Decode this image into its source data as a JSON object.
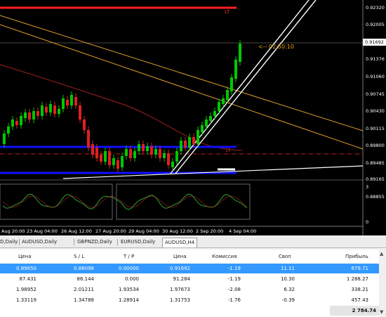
{
  "chart": {
    "price_axis": [
      "0.92320",
      "0.92005",
      "0.91692",
      "0.91376",
      "0.91060",
      "0.90745",
      "0.90430",
      "0.90115",
      "0.89800",
      "0.89485",
      "0.89165",
      "0.88855"
    ],
    "current_price": "0.91692",
    "timer": "<-- 02:50:10",
    "line_label_top": "LT",
    "line_label_mid": "LT",
    "time_axis": [
      "Aug 20:00",
      "23 Aug 04:00",
      "26 Aug 12:00",
      "27 Aug 20:00",
      "29 Aug 04:00",
      "30 Aug 12:00",
      "2 Sep 20:00",
      "4 Sep 04:00"
    ],
    "indicator_levels": [
      "3",
      "0"
    ],
    "colors": {
      "bull": "#00c800",
      "bear": "#e02020",
      "trend_white": "#ffffff",
      "support_blue": "#1010ff",
      "resist_red": "#ff2020",
      "channel_orange": "#e0a030",
      "ma_red": "#b02020",
      "osc_green": "#2ea02e",
      "osc_red": "#c03030"
    }
  },
  "tabs": [
    {
      "label": "D,Daily"
    },
    {
      "label": "AUDUSD,Daily"
    },
    {
      "label": "GBPNZD,Daily"
    },
    {
      "label": "EURUSD,Daily"
    },
    {
      "label": "AUDUSD,H4"
    }
  ],
  "table": {
    "headers": [
      "Цена",
      "S / L",
      "T / P",
      "Цена",
      "Комиссия",
      "Своп",
      "Прибыль"
    ],
    "rows": [
      [
        "0.89650",
        "0.88098",
        "0.00000",
        "0.91692",
        "-1.19",
        "11.11",
        "679.71"
      ],
      [
        "87.431",
        "86.144",
        "0.000",
        "91.284",
        "-1.19",
        "10.30",
        "1 288.27"
      ],
      [
        "1.98952",
        "2.01211",
        "1.93534",
        "1.97673",
        "-2.08",
        "6.32",
        "338.21"
      ],
      [
        "1.33119",
        "1.34788",
        "1.28914",
        "1.31753",
        "-1.76",
        "-0.39",
        "457.43"
      ]
    ],
    "total": "2 784.74",
    "close_glyph": "×"
  }
}
